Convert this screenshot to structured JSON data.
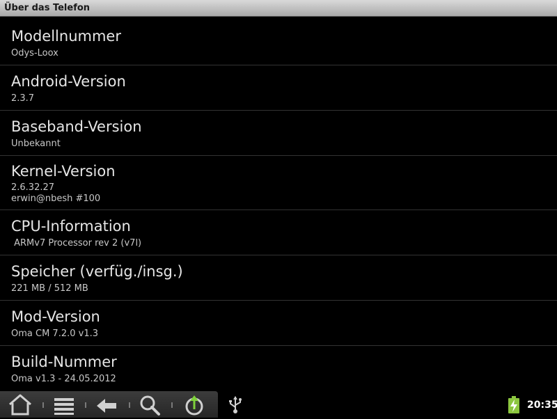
{
  "title_bar": {
    "title": "Über das Telefon"
  },
  "info_items": [
    {
      "label": "Modellnummer",
      "value": "Odys-Loox"
    },
    {
      "label": "Android-Version",
      "value": "2.3.7"
    },
    {
      "label": "Baseband-Version",
      "value": "Unbekannt"
    },
    {
      "label": "Kernel-Version",
      "value_line1": "2.6.32.27",
      "value_line2": "erwin@nbesh #100"
    },
    {
      "label": "CPU-Information",
      "value": " ARMv7 Processor rev 2 (v7l)"
    },
    {
      "label": "Speicher (verfüg./insg.)",
      "value": "221 MB / 512 MB"
    },
    {
      "label": "Mod-Version",
      "value": "Oma CM 7.2.0 v1.3"
    },
    {
      "label": "Build-Nummer",
      "value": "Oma v1.3 - 24.05.2012"
    }
  ],
  "nav_bar": {
    "buttons": [
      "home-icon",
      "menu-icon",
      "back-icon",
      "search-icon",
      "update-icon"
    ]
  },
  "status_bar": {
    "usb_icon": "usb-icon",
    "battery_icon": "battery-charging-icon",
    "clock": "20:35",
    "accent_color": "#8cc63f"
  }
}
